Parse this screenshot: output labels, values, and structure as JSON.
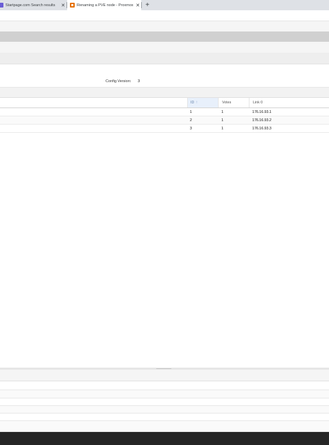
{
  "browser": {
    "tabs": [
      {
        "title": "Startpage.com Search results",
        "favicon": "startpage-favicon-icon",
        "close": "✕"
      },
      {
        "title": "Renaming a PVE node - Proxmox",
        "favicon": "proxmox-favicon-icon",
        "close": "✕"
      }
    ],
    "new_tab": "+"
  },
  "cluster_info": {
    "config_version_label": "Config Version:",
    "config_version_value": "3"
  },
  "nodes_grid": {
    "columns": {
      "id": "ID",
      "votes": "Votes",
      "link": "Link 0"
    },
    "sort_icon": "↑",
    "rows": [
      {
        "id": "1",
        "votes": "1",
        "link": "176.16.93.1"
      },
      {
        "id": "2",
        "votes": "1",
        "link": "176.16.93.2"
      },
      {
        "id": "3",
        "votes": "1",
        "link": "176.16.93.3"
      }
    ]
  },
  "colors": {
    "header_bar": "#d0d0d0",
    "sorted_column_bg": "#e8f0fb",
    "taskbar": "#262626"
  }
}
